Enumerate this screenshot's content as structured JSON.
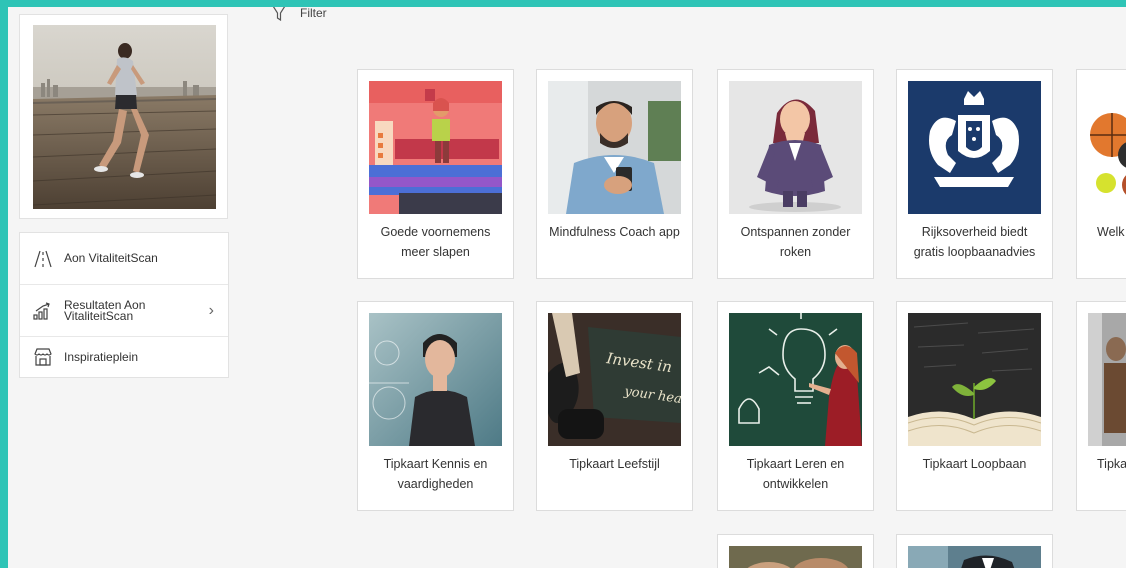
{
  "filter": {
    "label": "Filter"
  },
  "nav": [
    {
      "label": "Aon VitaliteitScan",
      "icon": "split-road-icon",
      "chevron": false
    },
    {
      "label": "Resultaten Aon VitaliteitScan",
      "icon": "growth-chart-icon",
      "chevron": true
    },
    {
      "label": "Inspiratieplein",
      "icon": "shop-icon",
      "chevron": false
    }
  ],
  "tiles": [
    {
      "caption": "Goede voornemens meer slapen"
    },
    {
      "caption": "Mindfulness Coach app"
    },
    {
      "caption": "Ontspannen zonder roken"
    },
    {
      "caption": "Rijksoverheid biedt gratis loopbaanadvies"
    },
    {
      "caption": "Welk"
    },
    {
      "caption": "Tipkaart Kennis en vaardigheden"
    },
    {
      "caption": "Tipkaart Leefstijl"
    },
    {
      "caption": "Tipkaart Leren en ontwikkelen"
    },
    {
      "caption": "Tipkaart Loopbaan"
    },
    {
      "caption": "Tipkaa"
    }
  ],
  "images": {
    "chalkboard_text": "Invest in your health"
  },
  "colors": {
    "accent": "#2ec4b6",
    "navy": "#1b3a6b"
  }
}
